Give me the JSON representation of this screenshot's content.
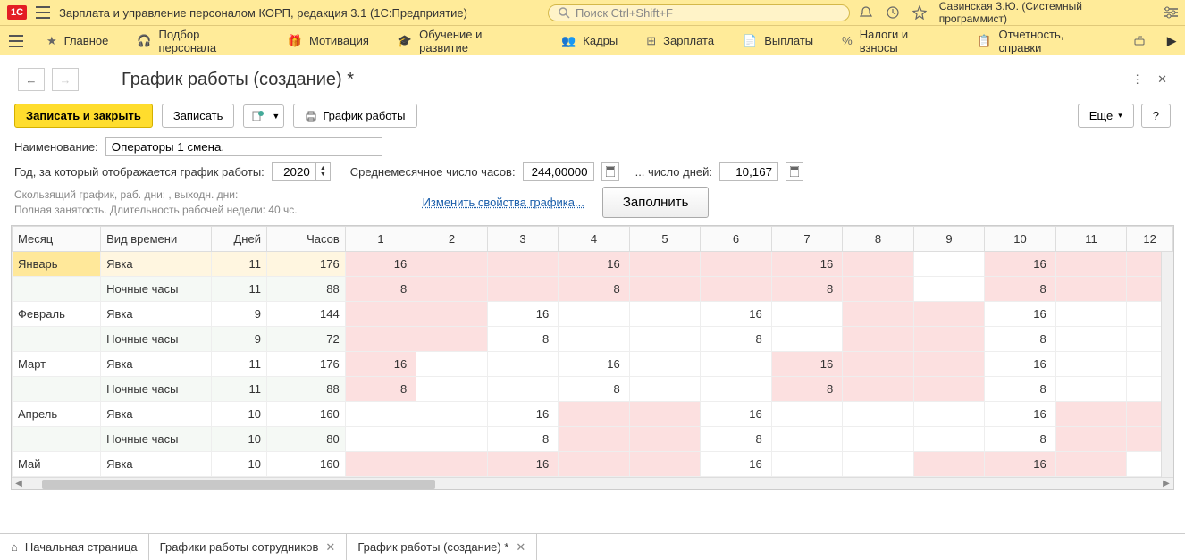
{
  "app": {
    "title": "Зарплата и управление персоналом КОРП, редакция 3.1  (1С:Предприятие)",
    "search_placeholder": "Поиск Ctrl+Shift+F",
    "user": "Савинская З.Ю. (Системный программист)"
  },
  "mainmenu": [
    {
      "label": "Главное"
    },
    {
      "label": "Подбор персонала"
    },
    {
      "label": "Мотивация"
    },
    {
      "label": "Обучение и развитие"
    },
    {
      "label": "Кадры"
    },
    {
      "label": "Зарплата"
    },
    {
      "label": "Выплаты"
    },
    {
      "label": "Налоги и взносы"
    },
    {
      "label": "Отчетность, справки"
    }
  ],
  "page": {
    "title": "График работы (создание) *"
  },
  "toolbar": {
    "save_close": "Записать и закрыть",
    "save": "Записать",
    "print": "График работы",
    "more": "Еще",
    "help": "?"
  },
  "form": {
    "name_label": "Наименование:",
    "name_value": "Операторы 1 смена.",
    "year_label": "Год, за который отображается график работы:",
    "year_value": "2020",
    "avg_hours_label": "Среднемесячное число часов:",
    "avg_hours_value": "244,00000",
    "avg_days_label": "... число дней:",
    "avg_days_value": "10,167",
    "info_line1": "Скользящий график, раб. дни: , выходн. дни:",
    "info_line2": "Полная занятость. Длительность рабочей недели: 40 чс.",
    "edit_props_link": "Изменить свойства графика...",
    "fill_btn": "Заполнить"
  },
  "table": {
    "headers": {
      "month": "Месяц",
      "type": "Вид времени",
      "days": "Дней",
      "hours": "Часов"
    },
    "day_cols": [
      "1",
      "2",
      "3",
      "4",
      "5",
      "6",
      "7",
      "8",
      "9",
      "10",
      "11",
      "12"
    ],
    "rows": [
      {
        "month": "Январь",
        "type": "Явка",
        "days": "11",
        "hours": "176",
        "cells": [
          {
            "v": "16",
            "c": "pink"
          },
          {
            "v": "",
            "c": "pink"
          },
          {
            "v": "",
            "c": "pink"
          },
          {
            "v": "16",
            "c": "pink"
          },
          {
            "v": "",
            "c": "pink"
          },
          {
            "v": "",
            "c": "pink"
          },
          {
            "v": "16",
            "c": "pink"
          },
          {
            "v": "",
            "c": "pink"
          },
          {
            "v": "",
            "c": "white"
          },
          {
            "v": "16",
            "c": "pink"
          },
          {
            "v": "",
            "c": "pink"
          },
          {
            "v": "",
            "c": "pink"
          }
        ],
        "style": "yavka-jan"
      },
      {
        "month": "",
        "type": "Ночные часы",
        "days": "11",
        "hours": "88",
        "cells": [
          {
            "v": "8",
            "c": "pink"
          },
          {
            "v": "",
            "c": "pink"
          },
          {
            "v": "",
            "c": "pink"
          },
          {
            "v": "8",
            "c": "pink"
          },
          {
            "v": "",
            "c": "pink"
          },
          {
            "v": "",
            "c": "pink"
          },
          {
            "v": "8",
            "c": "pink"
          },
          {
            "v": "",
            "c": "pink"
          },
          {
            "v": "",
            "c": "white"
          },
          {
            "v": "8",
            "c": "pink"
          },
          {
            "v": "",
            "c": "pink"
          },
          {
            "v": "",
            "c": "pink"
          }
        ],
        "style": "night"
      },
      {
        "month": "Февраль",
        "type": "Явка",
        "days": "9",
        "hours": "144",
        "cells": [
          {
            "v": "",
            "c": "pink"
          },
          {
            "v": "",
            "c": "pink"
          },
          {
            "v": "16",
            "c": "white"
          },
          {
            "v": "",
            "c": "white"
          },
          {
            "v": "",
            "c": "white"
          },
          {
            "v": "16",
            "c": "white"
          },
          {
            "v": "",
            "c": "white"
          },
          {
            "v": "",
            "c": "pink"
          },
          {
            "v": "",
            "c": "pink"
          },
          {
            "v": "16",
            "c": "white"
          },
          {
            "v": "",
            "c": "white"
          },
          {
            "v": "",
            "c": "white"
          }
        ],
        "style": "plain"
      },
      {
        "month": "",
        "type": "Ночные часы",
        "days": "9",
        "hours": "72",
        "cells": [
          {
            "v": "",
            "c": "pink"
          },
          {
            "v": "",
            "c": "pink"
          },
          {
            "v": "8",
            "c": "white"
          },
          {
            "v": "",
            "c": "white"
          },
          {
            "v": "",
            "c": "white"
          },
          {
            "v": "8",
            "c": "white"
          },
          {
            "v": "",
            "c": "white"
          },
          {
            "v": "",
            "c": "pink"
          },
          {
            "v": "",
            "c": "pink"
          },
          {
            "v": "8",
            "c": "white"
          },
          {
            "v": "",
            "c": "white"
          },
          {
            "v": "",
            "c": "white"
          }
        ],
        "style": "night"
      },
      {
        "month": "Март",
        "type": "Явка",
        "days": "11",
        "hours": "176",
        "cells": [
          {
            "v": "16",
            "c": "pink"
          },
          {
            "v": "",
            "c": "white"
          },
          {
            "v": "",
            "c": "white"
          },
          {
            "v": "16",
            "c": "white"
          },
          {
            "v": "",
            "c": "white"
          },
          {
            "v": "",
            "c": "white"
          },
          {
            "v": "16",
            "c": "pink"
          },
          {
            "v": "",
            "c": "pink"
          },
          {
            "v": "",
            "c": "pink"
          },
          {
            "v": "16",
            "c": "white"
          },
          {
            "v": "",
            "c": "white"
          },
          {
            "v": "",
            "c": "white"
          }
        ],
        "style": "plain"
      },
      {
        "month": "",
        "type": "Ночные часы",
        "days": "11",
        "hours": "88",
        "cells": [
          {
            "v": "8",
            "c": "pink"
          },
          {
            "v": "",
            "c": "white"
          },
          {
            "v": "",
            "c": "white"
          },
          {
            "v": "8",
            "c": "white"
          },
          {
            "v": "",
            "c": "white"
          },
          {
            "v": "",
            "c": "white"
          },
          {
            "v": "8",
            "c": "pink"
          },
          {
            "v": "",
            "c": "pink"
          },
          {
            "v": "",
            "c": "pink"
          },
          {
            "v": "8",
            "c": "white"
          },
          {
            "v": "",
            "c": "white"
          },
          {
            "v": "",
            "c": "white"
          }
        ],
        "style": "night"
      },
      {
        "month": "Апрель",
        "type": "Явка",
        "days": "10",
        "hours": "160",
        "cells": [
          {
            "v": "",
            "c": "white"
          },
          {
            "v": "",
            "c": "white"
          },
          {
            "v": "16",
            "c": "white"
          },
          {
            "v": "",
            "c": "pink"
          },
          {
            "v": "",
            "c": "pink"
          },
          {
            "v": "16",
            "c": "white"
          },
          {
            "v": "",
            "c": "white"
          },
          {
            "v": "",
            "c": "white"
          },
          {
            "v": "",
            "c": "white"
          },
          {
            "v": "16",
            "c": "white"
          },
          {
            "v": "",
            "c": "pink"
          },
          {
            "v": "",
            "c": "pink"
          }
        ],
        "style": "plain"
      },
      {
        "month": "",
        "type": "Ночные часы",
        "days": "10",
        "hours": "80",
        "cells": [
          {
            "v": "",
            "c": "white"
          },
          {
            "v": "",
            "c": "white"
          },
          {
            "v": "8",
            "c": "white"
          },
          {
            "v": "",
            "c": "pink"
          },
          {
            "v": "",
            "c": "pink"
          },
          {
            "v": "8",
            "c": "white"
          },
          {
            "v": "",
            "c": "white"
          },
          {
            "v": "",
            "c": "white"
          },
          {
            "v": "",
            "c": "white"
          },
          {
            "v": "8",
            "c": "white"
          },
          {
            "v": "",
            "c": "pink"
          },
          {
            "v": "",
            "c": "pink"
          }
        ],
        "style": "night"
      },
      {
        "month": "Май",
        "type": "Явка",
        "days": "10",
        "hours": "160",
        "cells": [
          {
            "v": "",
            "c": "pink"
          },
          {
            "v": "",
            "c": "pink"
          },
          {
            "v": "16",
            "c": "pink"
          },
          {
            "v": "",
            "c": "pink"
          },
          {
            "v": "",
            "c": "pink"
          },
          {
            "v": "16",
            "c": "white"
          },
          {
            "v": "",
            "c": "white"
          },
          {
            "v": "",
            "c": "white"
          },
          {
            "v": "",
            "c": "pink"
          },
          {
            "v": "16",
            "c": "pink"
          },
          {
            "v": "",
            "c": "pink"
          },
          {
            "v": "",
            "c": "white"
          }
        ],
        "style": "plain"
      }
    ]
  },
  "bottom_tabs": [
    {
      "label": "Начальная страница",
      "closable": false
    },
    {
      "label": "Графики работы сотрудников",
      "closable": true
    },
    {
      "label": "График работы (создание) *",
      "closable": true
    }
  ]
}
